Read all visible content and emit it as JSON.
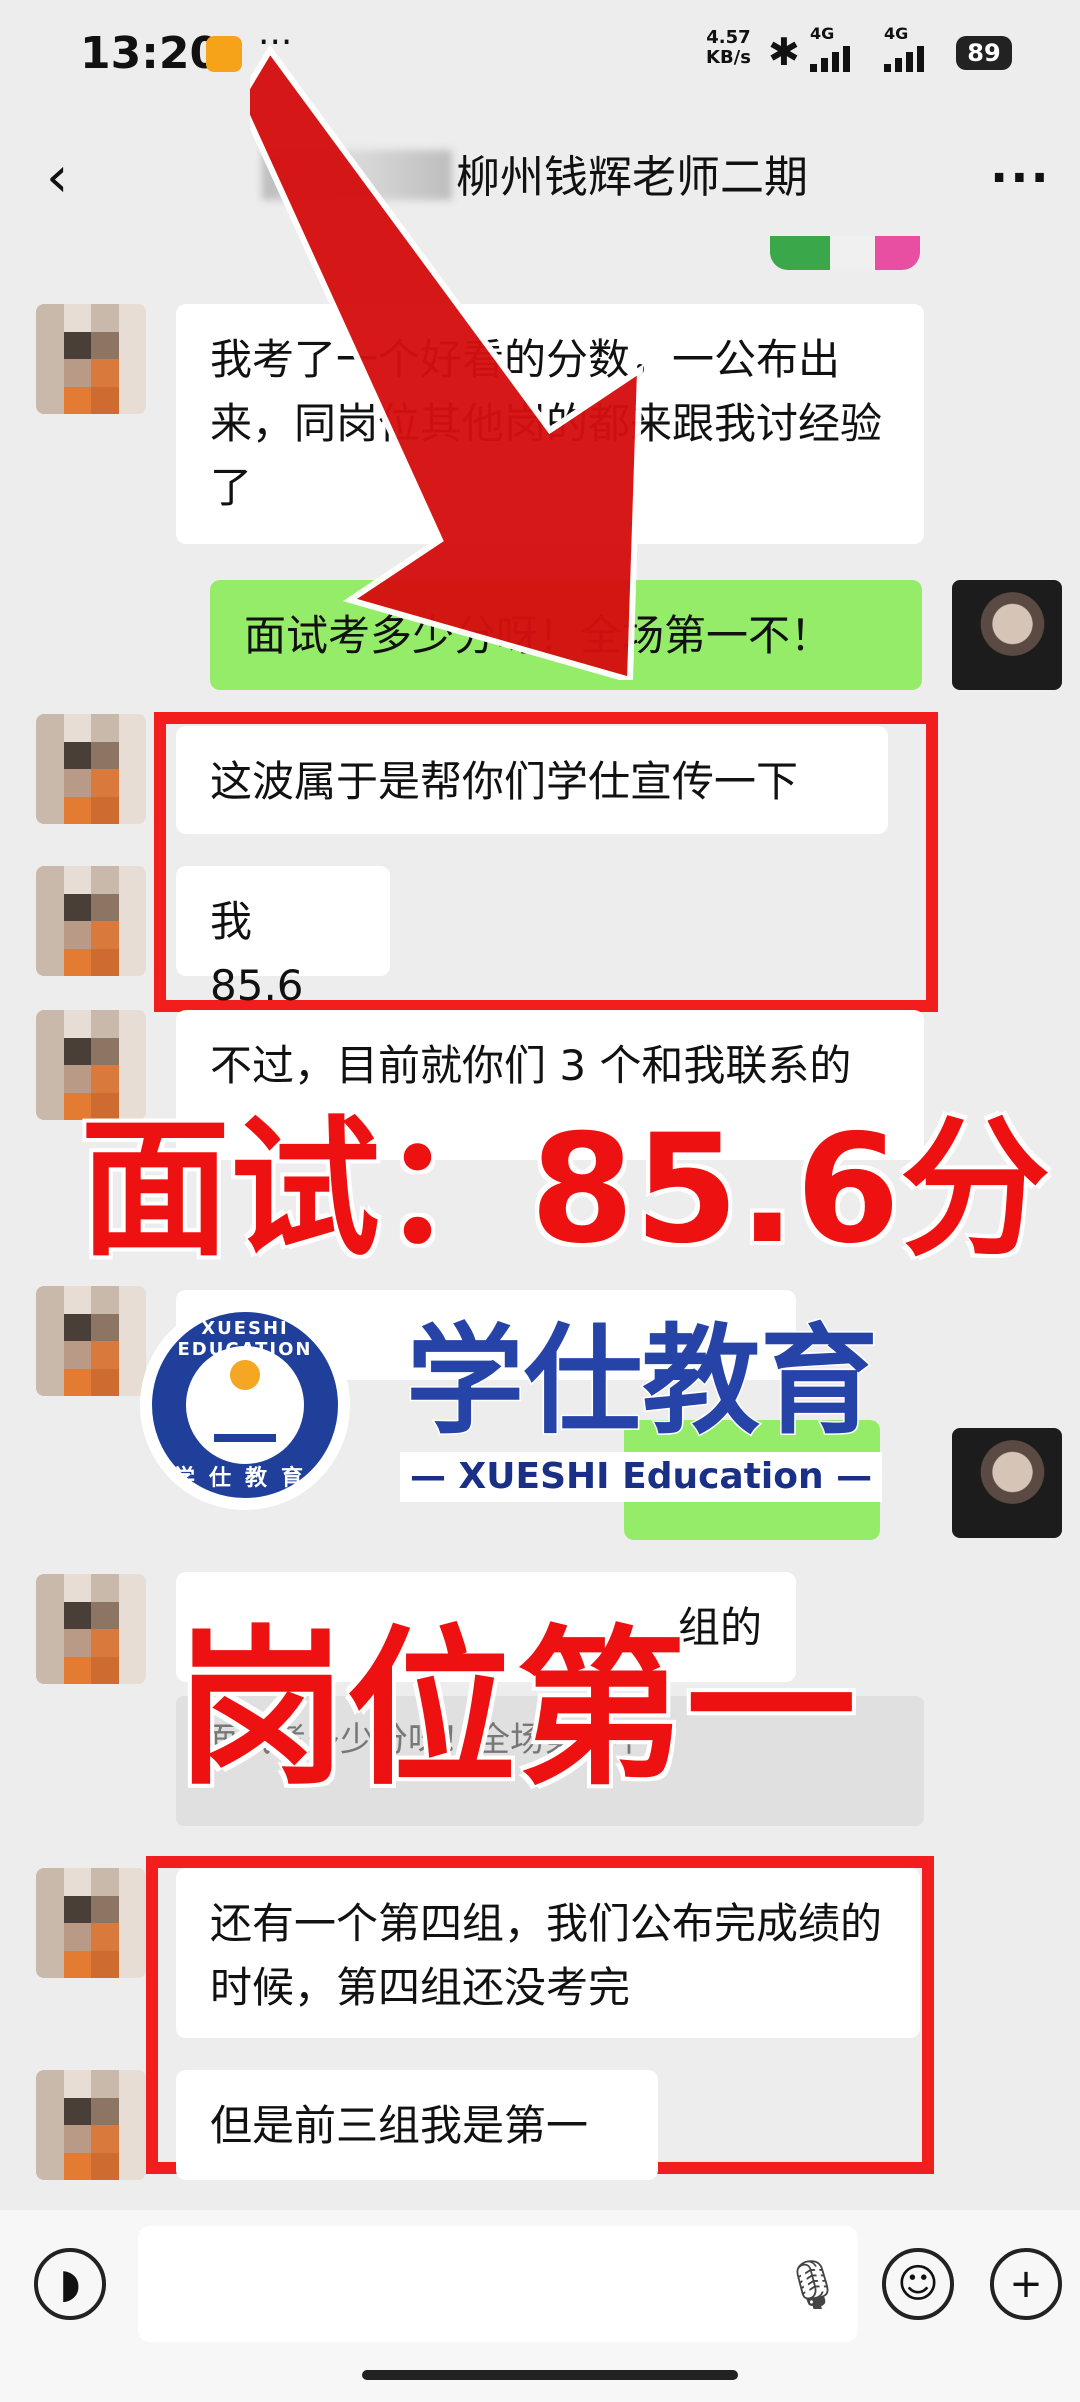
{
  "status": {
    "time": "13:20",
    "speed_value": "4.57",
    "speed_unit": "KB/s",
    "network1": "4G",
    "network2": "4G",
    "battery": "89"
  },
  "nav": {
    "title": "柳州钱辉老师二期",
    "back_icon": "back-arrow-icon",
    "more_icon": "more-dots-icon"
  },
  "messages": [
    {
      "from": "other",
      "text": "我考了一个好看的分数，一公布出来，同岗位其他岗的都来跟我讨经验了"
    },
    {
      "from": "me",
      "text": "面试考多少分呀！全场第一不！"
    },
    {
      "from": "other",
      "text": "这波属于是帮你们学仕宣传一下"
    },
    {
      "from": "other",
      "text": "我 85.6"
    },
    {
      "from": "other",
      "text": "不过，目前就你们 3 个和我联系的"
    },
    {
      "from": "other",
      "text": "组的"
    },
    {
      "from": "other",
      "quote": "面试考多少分呀！全场第一不！"
    },
    {
      "from": "other",
      "text": "还有一个第四组，我们公布完成绩的时候，第四组还没考完"
    },
    {
      "from": "other",
      "text": "但是前三组我是第一"
    }
  ],
  "overlay": {
    "score": "面试：85.6分",
    "rank": "岗位第一",
    "brand_cn": "学仕教育",
    "brand_en": "— XUESHI Education —",
    "logo_ring_top": "XUESHI EDUCATION",
    "logo_ring_bottom": "学仕教育"
  },
  "input_bar": {
    "voice_icon": "voice-icon",
    "mic_icon": "mic-icon",
    "emoji_icon": "emoji-icon",
    "plus_icon": "plus-icon"
  },
  "colors": {
    "background": "#ededed",
    "my_bubble": "#95ec69",
    "highlight_red": "#f21d1d",
    "brand_blue": "#2644a8"
  }
}
